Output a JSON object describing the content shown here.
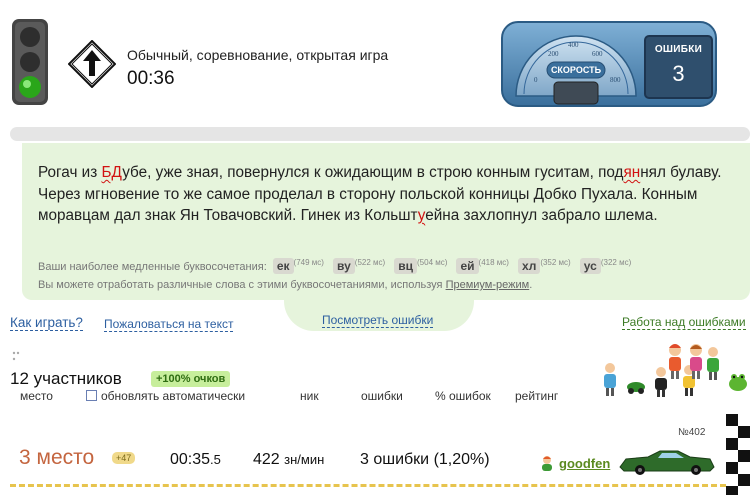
{
  "header": {
    "mode": "Обычный, соревнование, открытая игра",
    "timer": "00:36"
  },
  "dashboard": {
    "speedometer_label": "СКОРОСТЬ",
    "scale": [
      "0",
      "200",
      "400",
      "600",
      "800"
    ],
    "errors_label": "ОШИБКИ",
    "errors_count": "3"
  },
  "text": {
    "p1": "Рогач из ",
    "e1": "БД",
    "p2": "убе, уже зная, повернулся к ожидающим в строю конным гуситам, под",
    "e2": "ян",
    "p3": "нял булаву. Через мгновение то же самое проделал в сторону польской конницы Добко Пухала. Конным моравцам дал знак Ян Товачовский. Гинек из Кольшт",
    "e3": "у",
    "p4": "ейна захлопнул забрало шлема."
  },
  "slow_combos": {
    "label": "Ваши наиболее медленные буквосочетания:",
    "items": [
      {
        "combo": "ек",
        "ms": "(749 мс)"
      },
      {
        "combo": "ву",
        "ms": "(522 мс)"
      },
      {
        "combo": "вц",
        "ms": "(504 мс)"
      },
      {
        "combo": "ей",
        "ms": "(418 мс)"
      },
      {
        "combo": "хл",
        "ms": "(352 мс)"
      },
      {
        "combo": "ус",
        "ms": "(322 мс)"
      }
    ],
    "practice_prefix": "Вы можете отработать различные слова с этими буквосочетаниями, используя ",
    "practice_link": "Премиум-режим",
    "practice_suffix": "."
  },
  "links": {
    "how_to_play": "Как играть?",
    "report_text": "Пожаловаться на текст",
    "view_errors": "Посмотреть ошибки",
    "work_on_errors": "Работа над ошибками"
  },
  "participants": {
    "count_label": "12 участников",
    "bonus": "+100% очков",
    "columns": {
      "place": "место",
      "auto_update": "обновлять автоматически",
      "nick": "ник",
      "errors": "ошибки",
      "errors_pct": "% ошибок",
      "rating": "рейтинг"
    }
  },
  "result": {
    "record_no": "№402",
    "place": "3 место",
    "place_bonus": "+47",
    "time_main": "00:35",
    "time_frac": ".5",
    "speed": "422",
    "speed_unit": "зн/мин",
    "errors": "3 ошибки (1,20%)",
    "nick": "goodfen"
  },
  "colors": {
    "panel_bg": "#e6f4dc",
    "error_red": "#d21212",
    "link_blue": "#2d5fa0",
    "link_green": "#3c7a25",
    "place_orange": "#c4653f",
    "dashboard_blue": "#3f7aa8"
  }
}
